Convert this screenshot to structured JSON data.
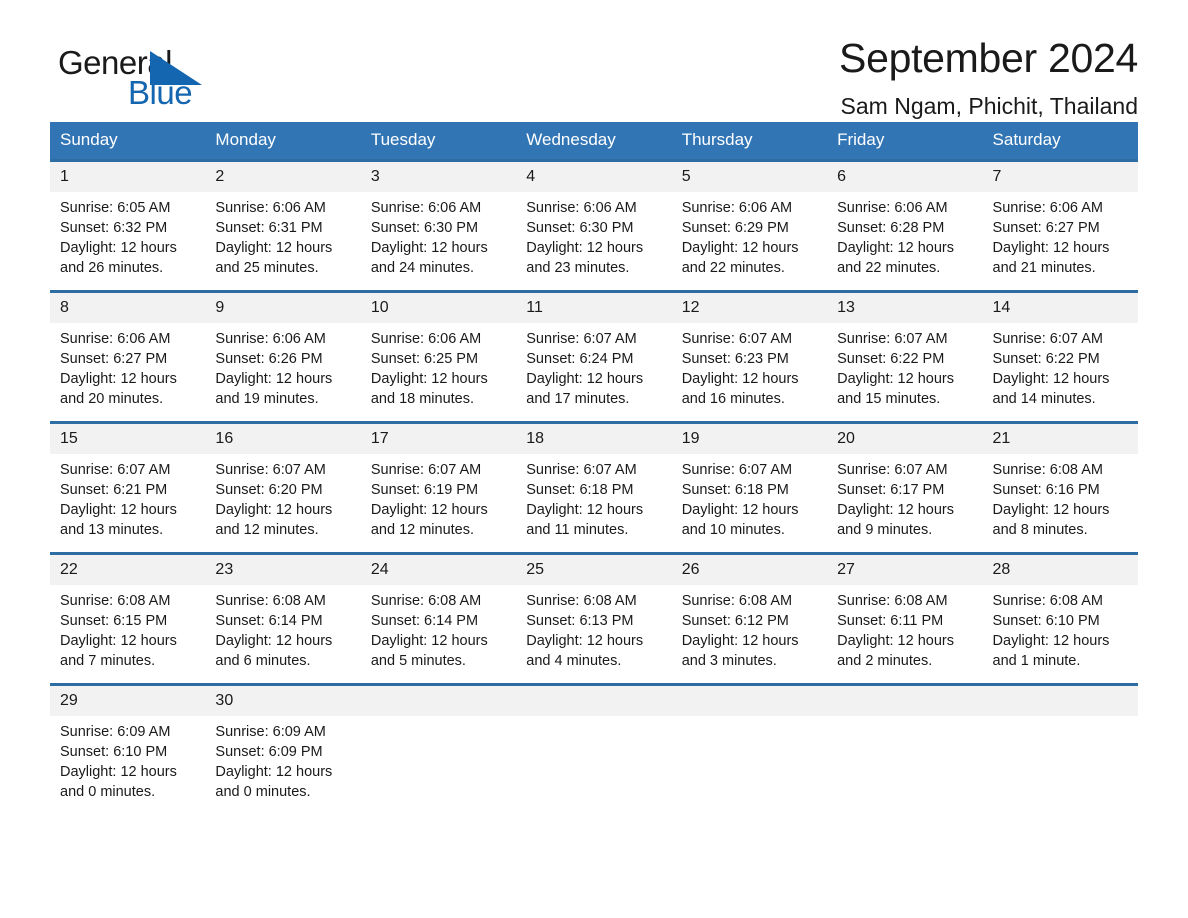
{
  "brand": {
    "name_part1": "General",
    "name_part2": "Blue",
    "logo_icon": "triangle-icon",
    "accent_color": "#1566b0"
  },
  "header": {
    "title": "September 2024",
    "subtitle": "Sam Ngam, Phichit, Thailand",
    "header_bg_color": "#3275b5",
    "row_divider_color": "#2e6ca4",
    "daynum_bg_color": "#f2f2f2"
  },
  "calendar": {
    "weekday_headers": [
      "Sunday",
      "Monday",
      "Tuesday",
      "Wednesday",
      "Thursday",
      "Friday",
      "Saturday"
    ],
    "weeks": [
      [
        {
          "day": "1",
          "sunrise": "Sunrise: 6:05 AM",
          "sunset": "Sunset: 6:32 PM",
          "daylight_line1": "Daylight: 12 hours",
          "daylight_line2": "and 26 minutes."
        },
        {
          "day": "2",
          "sunrise": "Sunrise: 6:06 AM",
          "sunset": "Sunset: 6:31 PM",
          "daylight_line1": "Daylight: 12 hours",
          "daylight_line2": "and 25 minutes."
        },
        {
          "day": "3",
          "sunrise": "Sunrise: 6:06 AM",
          "sunset": "Sunset: 6:30 PM",
          "daylight_line1": "Daylight: 12 hours",
          "daylight_line2": "and 24 minutes."
        },
        {
          "day": "4",
          "sunrise": "Sunrise: 6:06 AM",
          "sunset": "Sunset: 6:30 PM",
          "daylight_line1": "Daylight: 12 hours",
          "daylight_line2": "and 23 minutes."
        },
        {
          "day": "5",
          "sunrise": "Sunrise: 6:06 AM",
          "sunset": "Sunset: 6:29 PM",
          "daylight_line1": "Daylight: 12 hours",
          "daylight_line2": "and 22 minutes."
        },
        {
          "day": "6",
          "sunrise": "Sunrise: 6:06 AM",
          "sunset": "Sunset: 6:28 PM",
          "daylight_line1": "Daylight: 12 hours",
          "daylight_line2": "and 22 minutes."
        },
        {
          "day": "7",
          "sunrise": "Sunrise: 6:06 AM",
          "sunset": "Sunset: 6:27 PM",
          "daylight_line1": "Daylight: 12 hours",
          "daylight_line2": "and 21 minutes."
        }
      ],
      [
        {
          "day": "8",
          "sunrise": "Sunrise: 6:06 AM",
          "sunset": "Sunset: 6:27 PM",
          "daylight_line1": "Daylight: 12 hours",
          "daylight_line2": "and 20 minutes."
        },
        {
          "day": "9",
          "sunrise": "Sunrise: 6:06 AM",
          "sunset": "Sunset: 6:26 PM",
          "daylight_line1": "Daylight: 12 hours",
          "daylight_line2": "and 19 minutes."
        },
        {
          "day": "10",
          "sunrise": "Sunrise: 6:06 AM",
          "sunset": "Sunset: 6:25 PM",
          "daylight_line1": "Daylight: 12 hours",
          "daylight_line2": "and 18 minutes."
        },
        {
          "day": "11",
          "sunrise": "Sunrise: 6:07 AM",
          "sunset": "Sunset: 6:24 PM",
          "daylight_line1": "Daylight: 12 hours",
          "daylight_line2": "and 17 minutes."
        },
        {
          "day": "12",
          "sunrise": "Sunrise: 6:07 AM",
          "sunset": "Sunset: 6:23 PM",
          "daylight_line1": "Daylight: 12 hours",
          "daylight_line2": "and 16 minutes."
        },
        {
          "day": "13",
          "sunrise": "Sunrise: 6:07 AM",
          "sunset": "Sunset: 6:22 PM",
          "daylight_line1": "Daylight: 12 hours",
          "daylight_line2": "and 15 minutes."
        },
        {
          "day": "14",
          "sunrise": "Sunrise: 6:07 AM",
          "sunset": "Sunset: 6:22 PM",
          "daylight_line1": "Daylight: 12 hours",
          "daylight_line2": "and 14 minutes."
        }
      ],
      [
        {
          "day": "15",
          "sunrise": "Sunrise: 6:07 AM",
          "sunset": "Sunset: 6:21 PM",
          "daylight_line1": "Daylight: 12 hours",
          "daylight_line2": "and 13 minutes."
        },
        {
          "day": "16",
          "sunrise": "Sunrise: 6:07 AM",
          "sunset": "Sunset: 6:20 PM",
          "daylight_line1": "Daylight: 12 hours",
          "daylight_line2": "and 12 minutes."
        },
        {
          "day": "17",
          "sunrise": "Sunrise: 6:07 AM",
          "sunset": "Sunset: 6:19 PM",
          "daylight_line1": "Daylight: 12 hours",
          "daylight_line2": "and 12 minutes."
        },
        {
          "day": "18",
          "sunrise": "Sunrise: 6:07 AM",
          "sunset": "Sunset: 6:18 PM",
          "daylight_line1": "Daylight: 12 hours",
          "daylight_line2": "and 11 minutes."
        },
        {
          "day": "19",
          "sunrise": "Sunrise: 6:07 AM",
          "sunset": "Sunset: 6:18 PM",
          "daylight_line1": "Daylight: 12 hours",
          "daylight_line2": "and 10 minutes."
        },
        {
          "day": "20",
          "sunrise": "Sunrise: 6:07 AM",
          "sunset": "Sunset: 6:17 PM",
          "daylight_line1": "Daylight: 12 hours",
          "daylight_line2": "and 9 minutes."
        },
        {
          "day": "21",
          "sunrise": "Sunrise: 6:08 AM",
          "sunset": "Sunset: 6:16 PM",
          "daylight_line1": "Daylight: 12 hours",
          "daylight_line2": "and 8 minutes."
        }
      ],
      [
        {
          "day": "22",
          "sunrise": "Sunrise: 6:08 AM",
          "sunset": "Sunset: 6:15 PM",
          "daylight_line1": "Daylight: 12 hours",
          "daylight_line2": "and 7 minutes."
        },
        {
          "day": "23",
          "sunrise": "Sunrise: 6:08 AM",
          "sunset": "Sunset: 6:14 PM",
          "daylight_line1": "Daylight: 12 hours",
          "daylight_line2": "and 6 minutes."
        },
        {
          "day": "24",
          "sunrise": "Sunrise: 6:08 AM",
          "sunset": "Sunset: 6:14 PM",
          "daylight_line1": "Daylight: 12 hours",
          "daylight_line2": "and 5 minutes."
        },
        {
          "day": "25",
          "sunrise": "Sunrise: 6:08 AM",
          "sunset": "Sunset: 6:13 PM",
          "daylight_line1": "Daylight: 12 hours",
          "daylight_line2": "and 4 minutes."
        },
        {
          "day": "26",
          "sunrise": "Sunrise: 6:08 AM",
          "sunset": "Sunset: 6:12 PM",
          "daylight_line1": "Daylight: 12 hours",
          "daylight_line2": "and 3 minutes."
        },
        {
          "day": "27",
          "sunrise": "Sunrise: 6:08 AM",
          "sunset": "Sunset: 6:11 PM",
          "daylight_line1": "Daylight: 12 hours",
          "daylight_line2": "and 2 minutes."
        },
        {
          "day": "28",
          "sunrise": "Sunrise: 6:08 AM",
          "sunset": "Sunset: 6:10 PM",
          "daylight_line1": "Daylight: 12 hours",
          "daylight_line2": "and 1 minute."
        }
      ],
      [
        {
          "day": "29",
          "sunrise": "Sunrise: 6:09 AM",
          "sunset": "Sunset: 6:10 PM",
          "daylight_line1": "Daylight: 12 hours",
          "daylight_line2": "and 0 minutes."
        },
        {
          "day": "30",
          "sunrise": "Sunrise: 6:09 AM",
          "sunset": "Sunset: 6:09 PM",
          "daylight_line1": "Daylight: 12 hours",
          "daylight_line2": "and 0 minutes."
        },
        null,
        null,
        null,
        null,
        null
      ]
    ]
  }
}
